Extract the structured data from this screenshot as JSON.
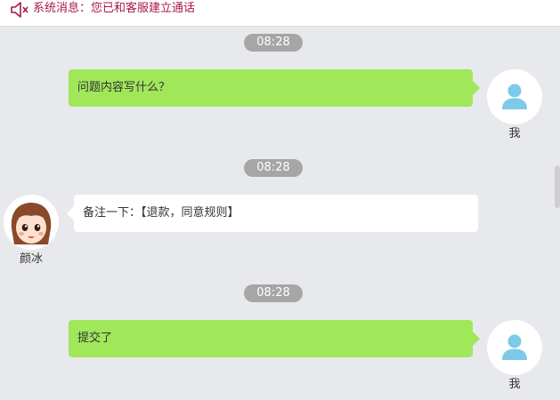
{
  "system_message": "系统消息：您已和客服建立通话",
  "messages": [
    {
      "time": "08:28",
      "sender": "我",
      "text": "问题内容写什么？"
    },
    {
      "time": "08:28",
      "sender": "颜冰",
      "text": "备注一下：【退款，同意规则】"
    },
    {
      "time": "08:28",
      "sender": "我",
      "text": "提交了"
    }
  ],
  "colors": {
    "system_text": "#a8174a",
    "my_bubble": "#a0e75a",
    "other_bubble": "#ffffff",
    "time_pill": "#a6a6a6",
    "background": "#e8e9ed",
    "user_icon": "#7dc9e8"
  },
  "icons": {
    "system": "speaker-icon",
    "my_avatar": "user-icon",
    "agent_avatar": "cartoon-girl-avatar"
  }
}
